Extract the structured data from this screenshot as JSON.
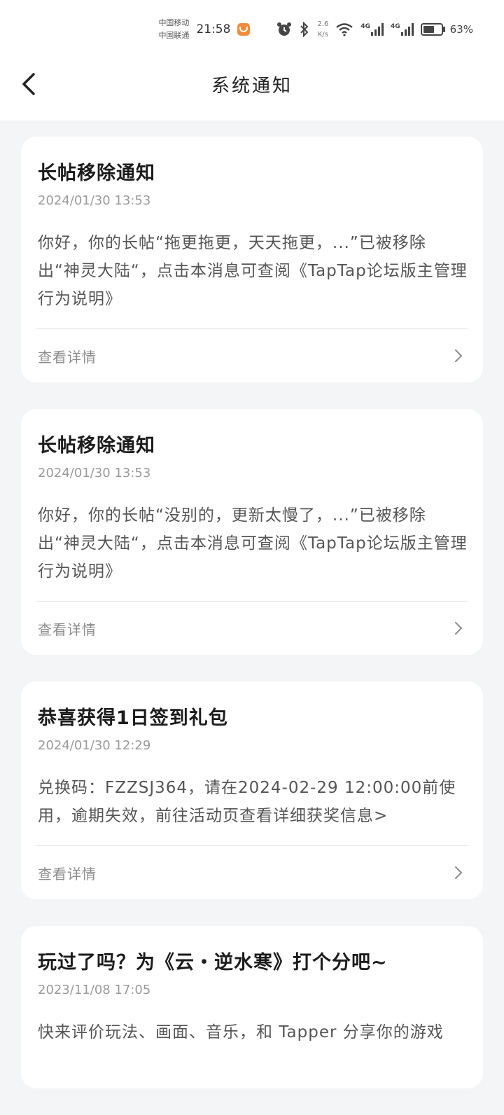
{
  "status_bar": {
    "carrier_1": "中国移动",
    "carrier_2": "中国联通",
    "time": "21:58",
    "speed_value": "2.6",
    "speed_unit": "K/s",
    "net_1": "4G",
    "net_2": "4G",
    "battery": "63%",
    "battery_level": 0.63
  },
  "header": {
    "title": "系统通知",
    "back_icon": "chevron-left-icon"
  },
  "notifications": [
    {
      "title": "长帖移除通知",
      "time": "2024/01/30  13:53",
      "body": "你好，你的长帖“拖更拖更，天天拖更，...”已被移除出“神灵大陆“，点击本消息可查阅《TapTap论坛版主管理行为说明》",
      "action": "查看详情"
    },
    {
      "title": "长帖移除通知",
      "time": "2024/01/30  13:53",
      "body": "你好，你的长帖“没别的，更新太慢了，...”已被移除出“神灵大陆“，点击本消息可查阅《TapTap论坛版主管理行为说明》",
      "action": "查看详情"
    },
    {
      "title": "恭喜获得1日签到礼包",
      "time": "2024/01/30  12:29",
      "body": "兑换码：FZZSJ364，请在2024-02-29 12:00:00前使用，逾期失效，前往活动页查看详细获奖信息>",
      "action": "查看详情"
    },
    {
      "title": "玩过了吗？为《云・逆水寒》打个分吧~",
      "time": "2023/11/08  17:05",
      "body": "快来评价玩法、画面、音乐，和 Tapper 分享你的游戏",
      "action": ""
    }
  ],
  "colors": {
    "page_bg": "#f4f5f7",
    "card_bg": "#ffffff",
    "title_text": "#1c1c1c",
    "body_text": "#555555",
    "muted_text": "#9a9a9a"
  }
}
